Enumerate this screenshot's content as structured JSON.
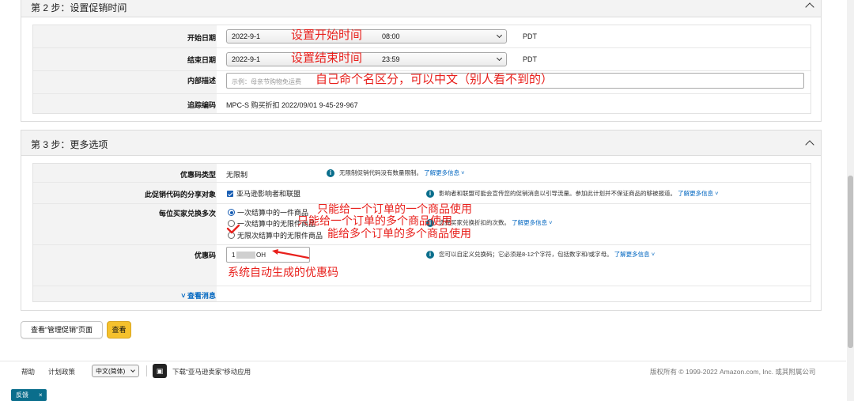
{
  "step2": {
    "title": "第 2 步：设置促销时间",
    "rows": {
      "start_date": {
        "label": "开始日期",
        "date": "2022-9-1",
        "time": "08:00",
        "tz": "PDT",
        "annotation": "设置开始时间"
      },
      "end_date": {
        "label": "结束日期",
        "date": "2022-9-1",
        "time": "23:59",
        "tz": "PDT",
        "annotation": "设置结束时间"
      },
      "internal_desc": {
        "label": "内部描述",
        "placeholder": "示例：母亲节购物免运费",
        "annotation": "自己命个名区分，可以中文（别人看不到的）"
      },
      "tracking_code": {
        "label": "追踪编码",
        "value": "MPC-S 购买折扣 2022/09/01 9-45-29-967"
      }
    }
  },
  "step3": {
    "title": "第 3 步：更多选项",
    "rows": {
      "coupon_type": {
        "label": "优惠码类型",
        "value": "无限制",
        "info": "无限制促销代码没有数量限制。",
        "link": "了解更多信息 ˅"
      },
      "share_target": {
        "label": "此促销代码的分享对象",
        "value": "亚马逊影响者和联盟",
        "info": "影响者和联盟可能会宣传您的促销消息以引导流量。参加此计划并不保证商品的够被报道。",
        "link": "了解更多信息 ˅"
      },
      "redemption": {
        "label": "每位买家兑换多次",
        "options": [
          "一次结算中的一件商品",
          "一次结算中的无限件商品",
          "无限次结算中的无限件商品"
        ],
        "info": "选择买家兑换折扣的次数。",
        "link": "了解更多信息 ˅",
        "annotations": [
          "只能给一个订单的一个商品使用",
          "只能给一个订单的多个商品使用",
          "能给多个订单的多个商品使用"
        ]
      },
      "coupon_code": {
        "label": "优惠码",
        "value_prefix": "1",
        "value_suffix": "OH",
        "info": "您可以自定义兑换码；它必须是8-12个字符，包括数字和/或字母。",
        "link": "了解更多信息 ˅",
        "annotation": "系统自动生成的优惠码"
      },
      "view_message": {
        "label": "˅ 查看消息"
      }
    }
  },
  "actions": {
    "manage_label": "查看“管理促销”页面",
    "view_label": "查看"
  },
  "footer": {
    "help": "帮助",
    "program_policy": "计划政策",
    "language": "中文(简体)",
    "download_app": "下载“亚马逊卖家”移动应用",
    "copyright": "版权所有 © 1999-2022 Amazon.com, Inc. 或其附属公司",
    "feedback": "反馈",
    "feedback_close": "×"
  },
  "colors": {
    "annotation": "#e8201c",
    "link": "#0066c0",
    "primary_button": "#f5c12d",
    "info_icon": "#0a6e8c"
  },
  "icons": {
    "collapse": "chevron-up-icon",
    "select": "chevron-down-icon",
    "info": "info-icon",
    "app": "phone-app-icon"
  }
}
